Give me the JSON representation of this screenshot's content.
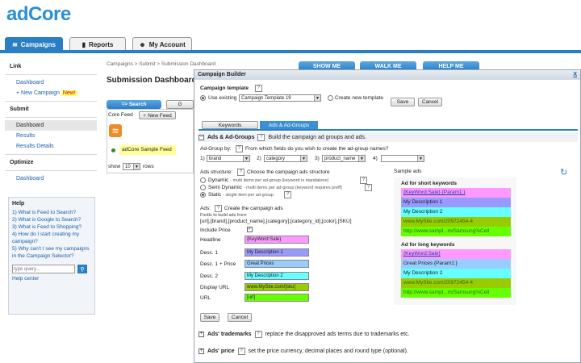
{
  "logo": "adCore",
  "nav_tabs": {
    "campaigns": "Campaigns",
    "reports": "Reports",
    "account": "My Account"
  },
  "sidebar": {
    "link_head": "Link",
    "link_dashboard": "Dashboard",
    "new_campaign": "+ New Campaign",
    "new_badge": "New!",
    "submit_head": "Submit",
    "submit_dashboard": "Dashboard",
    "results": "Results",
    "results_details": "Results Details",
    "optimize_head": "Optimize",
    "optimize_dashboard": "Dashboard"
  },
  "help": {
    "title": "Help",
    "q1": "1) What is Feed to Search?",
    "q2": "2) What is Google to Search?",
    "q3": "3) What is Feed to Shopping?",
    "q4": "4) How do I start creating my campaign?",
    "q5": "5) Why can't I see my campaigns in the Campaign Selector?",
    "search_placeholder": "type query...",
    "help_center": "Help center"
  },
  "main": {
    "breadcrumb": "Campaigns > Submit > Submission Dashboard",
    "title": "Submission Dashboard",
    "search_tab": "=> Search",
    "g_tab": "G",
    "core_feed": "Core Feed",
    "new_feed": "New Feed",
    "feed_name": "adCore Sample Feed",
    "show_label": "show",
    "show_value": "10",
    "rows_label": "rows",
    "top_btn1": "SHOW ME",
    "top_btn2": "WALK ME",
    "top_btn3": "HELP ME"
  },
  "modal": {
    "title": "Campaign Builder",
    "close": "X",
    "template_label": "Campaign template",
    "use_existing": "Use existing",
    "template_value": "Campaign Template 19",
    "create_new": "Create new template",
    "save": "Save",
    "cancel": "Cancel",
    "tab_keywords": "Keywords",
    "tab_ads": "Ads & Ad-Groups",
    "section_ads": "Ads & Ad-Groups",
    "section_ads_desc": "Build the campaign ad groups and ads.",
    "adgroup_label": "Ad-Group by:",
    "adgroup_desc": "From which fields do you wish to create the ad-group names?",
    "g1_label": "1)",
    "g1_value": "brand",
    "g2_label": "2)",
    "g2_value": "category",
    "g3_label": "3)",
    "g3_value": "product_name",
    "g4_label": "4)",
    "g4_value": "",
    "structure_label": "Ads structure:",
    "structure_desc": "Choose the campaign ads structure",
    "s_dynamic": "Dynamic",
    "s_dynamic_desc": "- multi items per ad-group (keyword is standalone)",
    "s_semi": "Semi Dynamic",
    "s_semi_desc": "- multi items per ad-group (keyword requires preff)",
    "s_static": "Static",
    "s_static_desc": "- single item per ad-group",
    "ads_label": "Ads:",
    "ads_desc": "Create the campaign ads",
    "fields_build": "Fields to build ads from:",
    "fields_list": "[url],[brand],[product_name],[category],[category_id],[color],[SKU]",
    "include_price": "Include Price",
    "headline_label": "Headline",
    "headline_value": "{KeyWord:Sale}",
    "desc1_label": "Desc. 1",
    "desc1_value": "My Description 1",
    "desc1p_label": "Desc. 1 + Price",
    "desc1p_value": "Great Prices",
    "desc2_label": "Desc. 2",
    "desc2_value": "My Description 2",
    "display_label": "Display URL",
    "display_value": "www.MySite.com/[sku]",
    "url_label": "URL",
    "url_value": "[url]",
    "sample_ads": "Sample ads",
    "short_head": "Ad for short keywords",
    "short_l1": "{KeyWord:Sale} {Param1:}",
    "short_l2": "My Description 1",
    "short_l3": "My Description 2",
    "short_l4": "www.MySite.com/20972454-4",
    "short_l5": "http://www.sampl...m/Samsung%Cell",
    "long_head": "Ad for long keywords",
    "long_l1": "{KeyWord:Sale}",
    "long_l2": "Great Prices {Param1:}",
    "long_l3": "My Description 2",
    "long_l4": "www.MySite.com/20972454-4",
    "long_l5": "http://www.sampl...m/Samsung%Cell",
    "trademarks": "Ads' trademarks",
    "trademarks_desc": "replace the disapproved ads terms due to trademarks etc.",
    "price": "Ads' price",
    "price_desc": "set the price currency, decimal places and round type (optional)."
  }
}
